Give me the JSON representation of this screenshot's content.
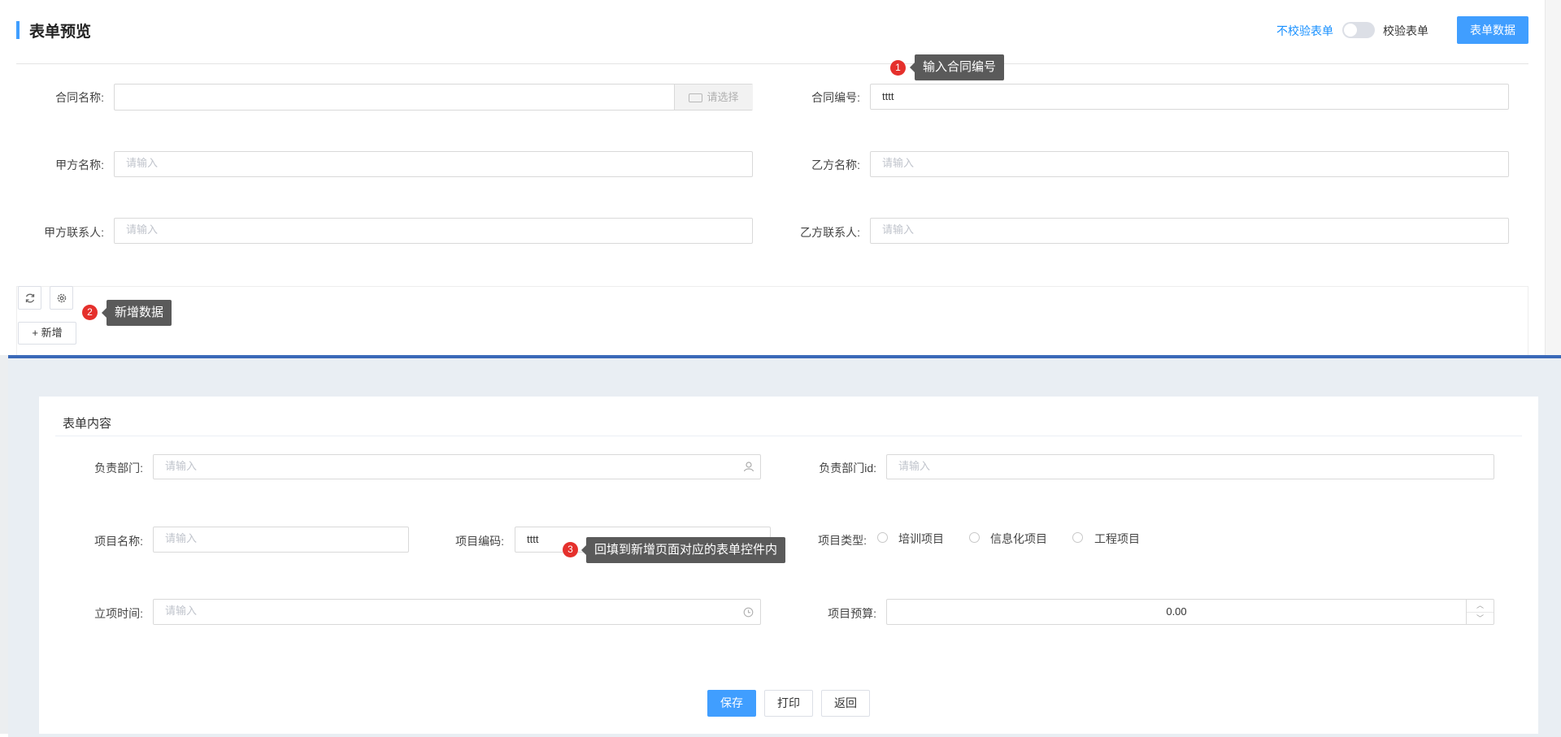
{
  "header": {
    "title": "表单预览",
    "no_validate_label": "不校验表单",
    "validate_label": "校验表单",
    "form_data_button": "表单数据",
    "colors": {
      "accent": "#409eff",
      "link": "#1890ff"
    }
  },
  "main_form": {
    "contract_name": {
      "label": "合同名称:",
      "value": "",
      "select_button": "请选择"
    },
    "contract_no": {
      "label": "合同编号:",
      "value": "tttt"
    },
    "party_a_name": {
      "label": "甲方名称:",
      "placeholder": "请输入"
    },
    "party_b_name": {
      "label": "乙方名称:",
      "placeholder": "请输入"
    },
    "party_a_contact": {
      "label": "甲方联系人:",
      "placeholder": "请输入"
    },
    "party_b_contact": {
      "label": "乙方联系人:",
      "placeholder": "请输入"
    }
  },
  "table_toolbar": {
    "refresh_icon": "refresh-icon",
    "settings_icon": "gear-icon",
    "add_button": "+ 新增"
  },
  "annotations": [
    {
      "num": "1",
      "text": "输入合同编号"
    },
    {
      "num": "2",
      "text": "新增数据"
    },
    {
      "num": "3",
      "text": "回填到新增页面对应的表单控件内"
    }
  ],
  "modal": {
    "section_title": "表单内容",
    "dept": {
      "label": "负责部门:",
      "placeholder": "请输入"
    },
    "dept_id": {
      "label": "负责部门id:",
      "placeholder": "请输入"
    },
    "project_name": {
      "label": "项目名称:",
      "placeholder": "请输入"
    },
    "project_code": {
      "label": "项目编码:",
      "value": "tttt"
    },
    "project_type": {
      "label": "项目类型:",
      "options": [
        "培训项目",
        "信息化项目",
        "工程项目"
      ]
    },
    "start_time": {
      "label": "立项时间:",
      "placeholder": "请输入"
    },
    "budget": {
      "label": "项目预算:",
      "value": "0.00"
    },
    "buttons": {
      "save": "保存",
      "print": "打印",
      "back": "返回"
    }
  }
}
